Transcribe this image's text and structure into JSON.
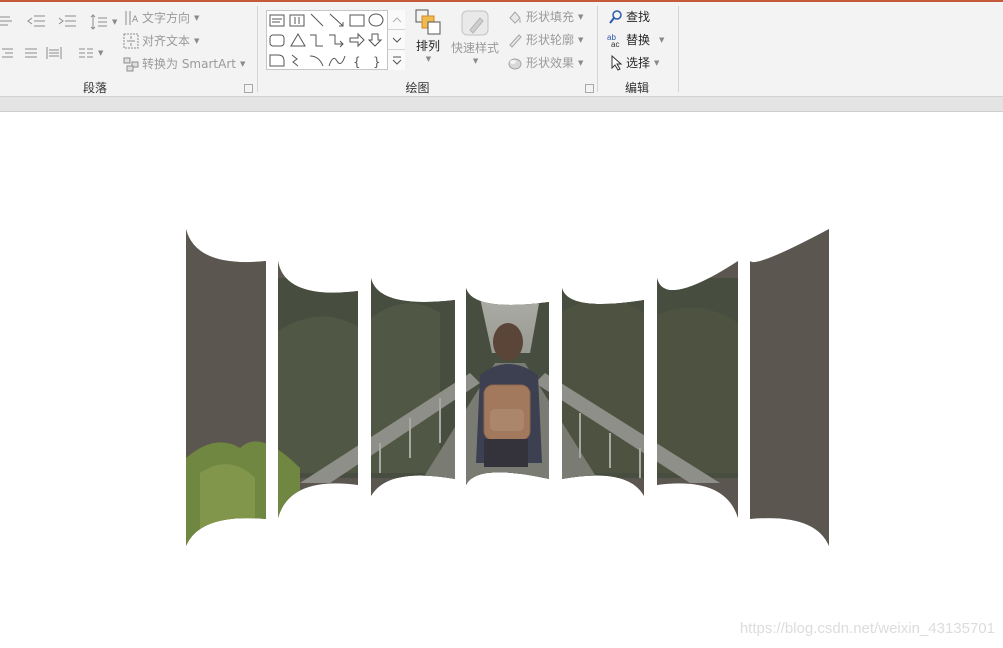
{
  "ribbon": {
    "paragraph": {
      "group_label": "段落",
      "text_direction_label": "文字方向",
      "align_text_label": "对齐文本",
      "convert_smartart_label": "转换为 SmartArt"
    },
    "drawing": {
      "group_label": "绘图",
      "arrange_label": "排列",
      "quick_styles_label": "快速样式",
      "shape_fill_label": "形状填充",
      "shape_outline_label": "形状轮廓",
      "shape_effects_label": "形状效果"
    },
    "editing": {
      "group_label": "编辑",
      "find_label": "查找",
      "replace_label": "替换",
      "select_label": "选择"
    }
  },
  "slide": {
    "watermark": "https://blog.csdn.net/weixin_43135701",
    "photo_panels": 7,
    "colors": {
      "panel_overlay": "#5b5650",
      "sky": "#cfd4cf",
      "forest": "#3e4a36",
      "jacket": "#2c3550",
      "backpack": "#c98c66",
      "grass": "#7aa23a"
    }
  },
  "icons": [
    "align-text-left-icon",
    "decrease-indent-icon",
    "increase-indent-icon",
    "line-spacing-icon",
    "text-direction-icon",
    "align-text-icon",
    "smartart-icon",
    "arrange-icon",
    "quick-styles-icon",
    "shape-fill-icon",
    "shape-outline-icon",
    "shape-effects-icon",
    "find-icon",
    "replace-icon",
    "select-icon"
  ]
}
